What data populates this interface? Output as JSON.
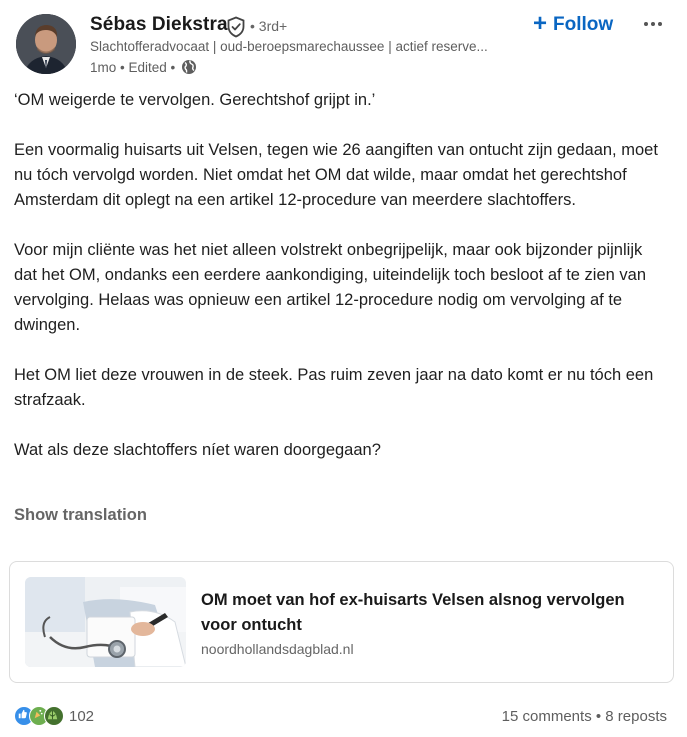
{
  "author": {
    "name": "Sébas Diekstra",
    "degree": "• 3rd+",
    "headline": "Slachtofferadvocaat | oud-beroepsmarechaussee | actief reserve...",
    "time": "1mo • Edited •",
    "verified_icon": "verified-shield-icon",
    "visibility_icon": "globe-icon"
  },
  "actions": {
    "follow_label": "Follow",
    "more_icon": "ellipsis-icon"
  },
  "post": {
    "paragraphs": [
      "‘OM weigerde te vervolgen. Gerechtshof grijpt in.’",
      "Een voormalig huisarts uit Velsen, tegen wie 26 aangiften van ontucht zijn gedaan, moet nu tóch vervolgd worden. Niet omdat het OM dat wilde, maar omdat het gerechtshof Amsterdam dit oplegt na een artikel 12-procedure van meerdere slachtoffers.",
      "Voor mijn cliënte was het niet alleen volstrekt onbegrijpelijk, maar ook bijzonder pijnlijk dat het OM, ondanks een eerdere aankondiging, uiteindelijk toch besloot af te zien van vervolging. Helaas was opnieuw een artikel 12-procedure nodig om vervolging af te dwingen.",
      "Het OM liet deze vrouwen in de steek. Pas ruim zeven jaar na dato komt er nu tóch een strafzaak.",
      "Wat als deze slachtoffers níet waren doorgegaan?"
    ],
    "show_translation": "Show translation"
  },
  "link_card": {
    "title": "OM moet van hof ex-huisarts Velsen alsnog vervolgen voor ontucht",
    "source": "noordhollandsdagblad.nl"
  },
  "social": {
    "reaction_icons": [
      "like-icon",
      "celebrate-icon",
      "support-icon"
    ],
    "reactions_count": "102",
    "comments": "15 comments",
    "separator": " • ",
    "reposts": "8 reposts"
  },
  "colors": {
    "accent": "#0a66c2",
    "like": "#378fe9",
    "celebrate": "#44712e",
    "support": "#d9654b"
  }
}
